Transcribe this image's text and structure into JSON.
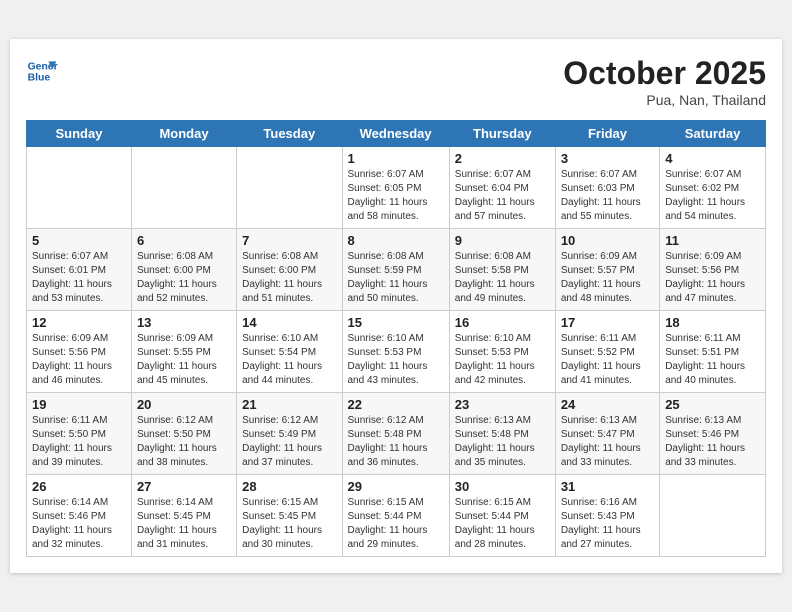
{
  "header": {
    "logo_line1": "General",
    "logo_line2": "Blue",
    "month": "October 2025",
    "location": "Pua, Nan, Thailand"
  },
  "weekdays": [
    "Sunday",
    "Monday",
    "Tuesday",
    "Wednesday",
    "Thursday",
    "Friday",
    "Saturday"
  ],
  "weeks": [
    [
      null,
      null,
      null,
      {
        "day": 1,
        "sunrise": "6:07 AM",
        "sunset": "6:05 PM",
        "daylight": "11 hours and 58 minutes."
      },
      {
        "day": 2,
        "sunrise": "6:07 AM",
        "sunset": "6:04 PM",
        "daylight": "11 hours and 57 minutes."
      },
      {
        "day": 3,
        "sunrise": "6:07 AM",
        "sunset": "6:03 PM",
        "daylight": "11 hours and 55 minutes."
      },
      {
        "day": 4,
        "sunrise": "6:07 AM",
        "sunset": "6:02 PM",
        "daylight": "11 hours and 54 minutes."
      }
    ],
    [
      {
        "day": 5,
        "sunrise": "6:07 AM",
        "sunset": "6:01 PM",
        "daylight": "11 hours and 53 minutes."
      },
      {
        "day": 6,
        "sunrise": "6:08 AM",
        "sunset": "6:00 PM",
        "daylight": "11 hours and 52 minutes."
      },
      {
        "day": 7,
        "sunrise": "6:08 AM",
        "sunset": "6:00 PM",
        "daylight": "11 hours and 51 minutes."
      },
      {
        "day": 8,
        "sunrise": "6:08 AM",
        "sunset": "5:59 PM",
        "daylight": "11 hours and 50 minutes."
      },
      {
        "day": 9,
        "sunrise": "6:08 AM",
        "sunset": "5:58 PM",
        "daylight": "11 hours and 49 minutes."
      },
      {
        "day": 10,
        "sunrise": "6:09 AM",
        "sunset": "5:57 PM",
        "daylight": "11 hours and 48 minutes."
      },
      {
        "day": 11,
        "sunrise": "6:09 AM",
        "sunset": "5:56 PM",
        "daylight": "11 hours and 47 minutes."
      }
    ],
    [
      {
        "day": 12,
        "sunrise": "6:09 AM",
        "sunset": "5:56 PM",
        "daylight": "11 hours and 46 minutes."
      },
      {
        "day": 13,
        "sunrise": "6:09 AM",
        "sunset": "5:55 PM",
        "daylight": "11 hours and 45 minutes."
      },
      {
        "day": 14,
        "sunrise": "6:10 AM",
        "sunset": "5:54 PM",
        "daylight": "11 hours and 44 minutes."
      },
      {
        "day": 15,
        "sunrise": "6:10 AM",
        "sunset": "5:53 PM",
        "daylight": "11 hours and 43 minutes."
      },
      {
        "day": 16,
        "sunrise": "6:10 AM",
        "sunset": "5:53 PM",
        "daylight": "11 hours and 42 minutes."
      },
      {
        "day": 17,
        "sunrise": "6:11 AM",
        "sunset": "5:52 PM",
        "daylight": "11 hours and 41 minutes."
      },
      {
        "day": 18,
        "sunrise": "6:11 AM",
        "sunset": "5:51 PM",
        "daylight": "11 hours and 40 minutes."
      }
    ],
    [
      {
        "day": 19,
        "sunrise": "6:11 AM",
        "sunset": "5:50 PM",
        "daylight": "11 hours and 39 minutes."
      },
      {
        "day": 20,
        "sunrise": "6:12 AM",
        "sunset": "5:50 PM",
        "daylight": "11 hours and 38 minutes."
      },
      {
        "day": 21,
        "sunrise": "6:12 AM",
        "sunset": "5:49 PM",
        "daylight": "11 hours and 37 minutes."
      },
      {
        "day": 22,
        "sunrise": "6:12 AM",
        "sunset": "5:48 PM",
        "daylight": "11 hours and 36 minutes."
      },
      {
        "day": 23,
        "sunrise": "6:13 AM",
        "sunset": "5:48 PM",
        "daylight": "11 hours and 35 minutes."
      },
      {
        "day": 24,
        "sunrise": "6:13 AM",
        "sunset": "5:47 PM",
        "daylight": "11 hours and 33 minutes."
      },
      {
        "day": 25,
        "sunrise": "6:13 AM",
        "sunset": "5:46 PM",
        "daylight": "11 hours and 33 minutes."
      }
    ],
    [
      {
        "day": 26,
        "sunrise": "6:14 AM",
        "sunset": "5:46 PM",
        "daylight": "11 hours and 32 minutes."
      },
      {
        "day": 27,
        "sunrise": "6:14 AM",
        "sunset": "5:45 PM",
        "daylight": "11 hours and 31 minutes."
      },
      {
        "day": 28,
        "sunrise": "6:15 AM",
        "sunset": "5:45 PM",
        "daylight": "11 hours and 30 minutes."
      },
      {
        "day": 29,
        "sunrise": "6:15 AM",
        "sunset": "5:44 PM",
        "daylight": "11 hours and 29 minutes."
      },
      {
        "day": 30,
        "sunrise": "6:15 AM",
        "sunset": "5:44 PM",
        "daylight": "11 hours and 28 minutes."
      },
      {
        "day": 31,
        "sunrise": "6:16 AM",
        "sunset": "5:43 PM",
        "daylight": "11 hours and 27 minutes."
      },
      null
    ]
  ]
}
